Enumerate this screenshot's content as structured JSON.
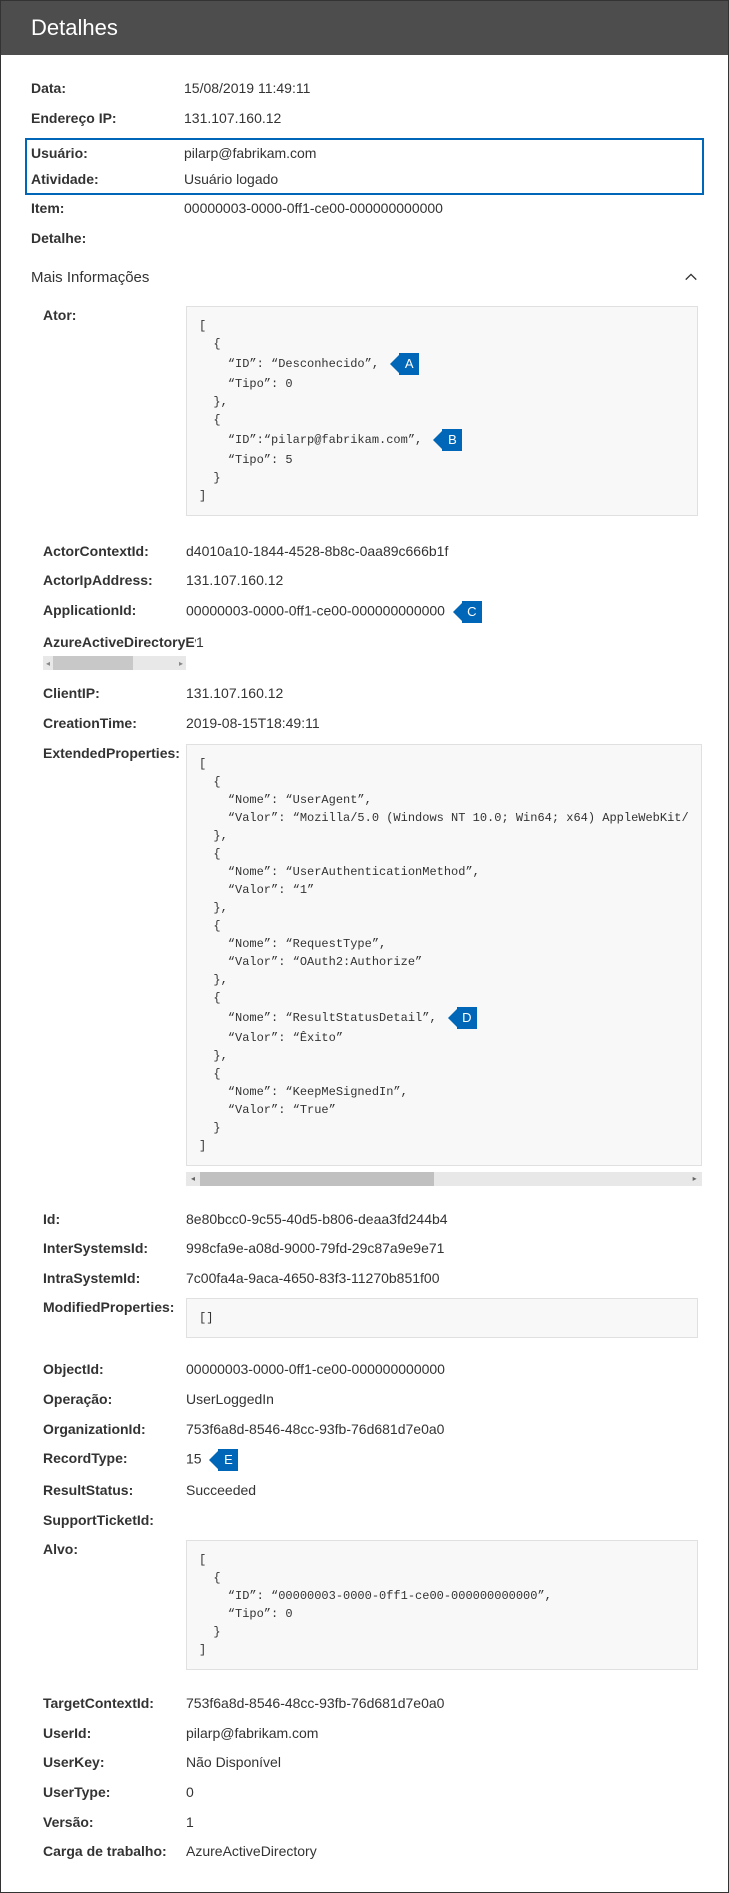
{
  "header": {
    "title": "Detalhes"
  },
  "top": {
    "data_label": "Data:",
    "data_value": "15/08/2019 11:49:11",
    "ip_label": "Endereço IP:",
    "ip_value": "131.107.160.12",
    "user_label": "Usuário:",
    "user_value": "pilarp@fabrikam.com",
    "activity_label": "Atividade:",
    "activity_value": "Usuário logado",
    "item_label": "Item:",
    "item_value": "00000003-0000-0ff1-ce00-000000000000",
    "detail_label": "Detalhe:",
    "detail_value": ""
  },
  "more_info_label": "Mais Informações",
  "ator": {
    "label": "Ator:",
    "line1": "[",
    "line2": "  {",
    "line3": "    “ID”: “Desconhecido”,",
    "line4": "    “Tipo”: 0",
    "line5": "  },",
    "line6": "  {",
    "line7": "    “ID”:“pilarp@fabrikam.com”,",
    "line8": "    “Tipo”: 5",
    "line9": "  }",
    "line10": "]"
  },
  "callouts": {
    "A": "A",
    "B": "B",
    "C": "C",
    "D": "D",
    "E": "E"
  },
  "fields": {
    "actor_context_id_label": "ActorContextId:",
    "actor_context_id_value": "d4010a10-1844-4528-8b8c-0aa89c666b1f",
    "actor_ip_label": "ActorIpAddress:",
    "actor_ip_value": "131.107.160.12",
    "application_id_label": "ApplicationId:",
    "application_id_value": "00000003-0000-0ff1-ce00-000000000000",
    "aad_event_label": "AzureActiveDirectoryEve",
    "aad_event_value": "1",
    "client_ip_label": "ClientIP:",
    "client_ip_value": "131.107.160.12",
    "creation_time_label": "CreationTime:",
    "creation_time_value": "2019-08-15T18:49:11",
    "extended_props_label": "ExtendedProperties:",
    "id_label": "Id:",
    "id_value": "8e80bcc0-9c55-40d5-b806-deaa3fd244b4",
    "intersystems_label": "InterSystemsId:",
    "intersystems_value": "998cfa9e-a08d-9000-79fd-29c87a9e9e71",
    "intrasystem_label": "IntraSystemId:",
    "intrasystem_value": "7c00fa4a-9aca-4650-83f3-11270b851f00",
    "modified_props_label": "ModifiedProperties:",
    "modified_props_value": "[]",
    "object_id_label": "ObjectId:",
    "object_id_value": "00000003-0000-0ff1-ce00-000000000000",
    "operacao_label": "Operação:",
    "operacao_value": "UserLoggedIn",
    "org_id_label": "OrganizationId:",
    "org_id_value": "753f6a8d-8546-48cc-93fb-76d681d7e0a0",
    "record_type_label": "RecordType:",
    "record_type_value": "15",
    "result_status_label": "ResultStatus:",
    "result_status_value": "Succeeded",
    "support_ticket_label": "SupportTicketId:",
    "support_ticket_value": "",
    "alvo_label": "Alvo:",
    "target_context_label": "TargetContextId:",
    "target_context_value": "753f6a8d-8546-48cc-93fb-76d681d7e0a0",
    "userid_label": "UserId:",
    "userid_value": "pilarp@fabrikam.com",
    "userkey_label": "UserKey:",
    "userkey_value": "Não Disponível",
    "usertype_label": "UserType:",
    "usertype_value": "0",
    "versao_label": "Versão:",
    "versao_value": "1",
    "workload_label": "Carga de trabalho:",
    "workload_value": "AzureActiveDirectory"
  },
  "ext": {
    "l1": "[",
    "l2": "  {",
    "l3": "    “Nome”: “UserAgent”,",
    "l4": "    “Valor”: “Mozilla/5.0 (Windows NT 10.0; Win64; x64) AppleWebKit/",
    "l5": "  },",
    "l6": "  {",
    "l7": "    “Nome”: “UserAuthenticationMethod”,",
    "l8": "    “Valor”: “1”",
    "l9": "  },",
    "l10": "  {",
    "l11": "    “Nome”: “RequestType”,",
    "l12": "    “Valor”: “OAuth2:Authorize”",
    "l13": "  },",
    "l14": "  {",
    "l15": "    “Nome”: “ResultStatusDetail”,",
    "l16": "    “Valor”: “Êxito”",
    "l17": "  },",
    "l18": "  {",
    "l19": "    “Nome”: “KeepMeSignedIn”,",
    "l20": "    “Valor”: “True”",
    "l21": "  }",
    "l22": "]"
  },
  "alvo": {
    "l1": "[",
    "l2": "  {",
    "l3": "    “ID”: “00000003-0000-0ff1-ce00-000000000000”,",
    "l4": "    “Tipo”: 0",
    "l5": "  }",
    "l6": "]"
  }
}
